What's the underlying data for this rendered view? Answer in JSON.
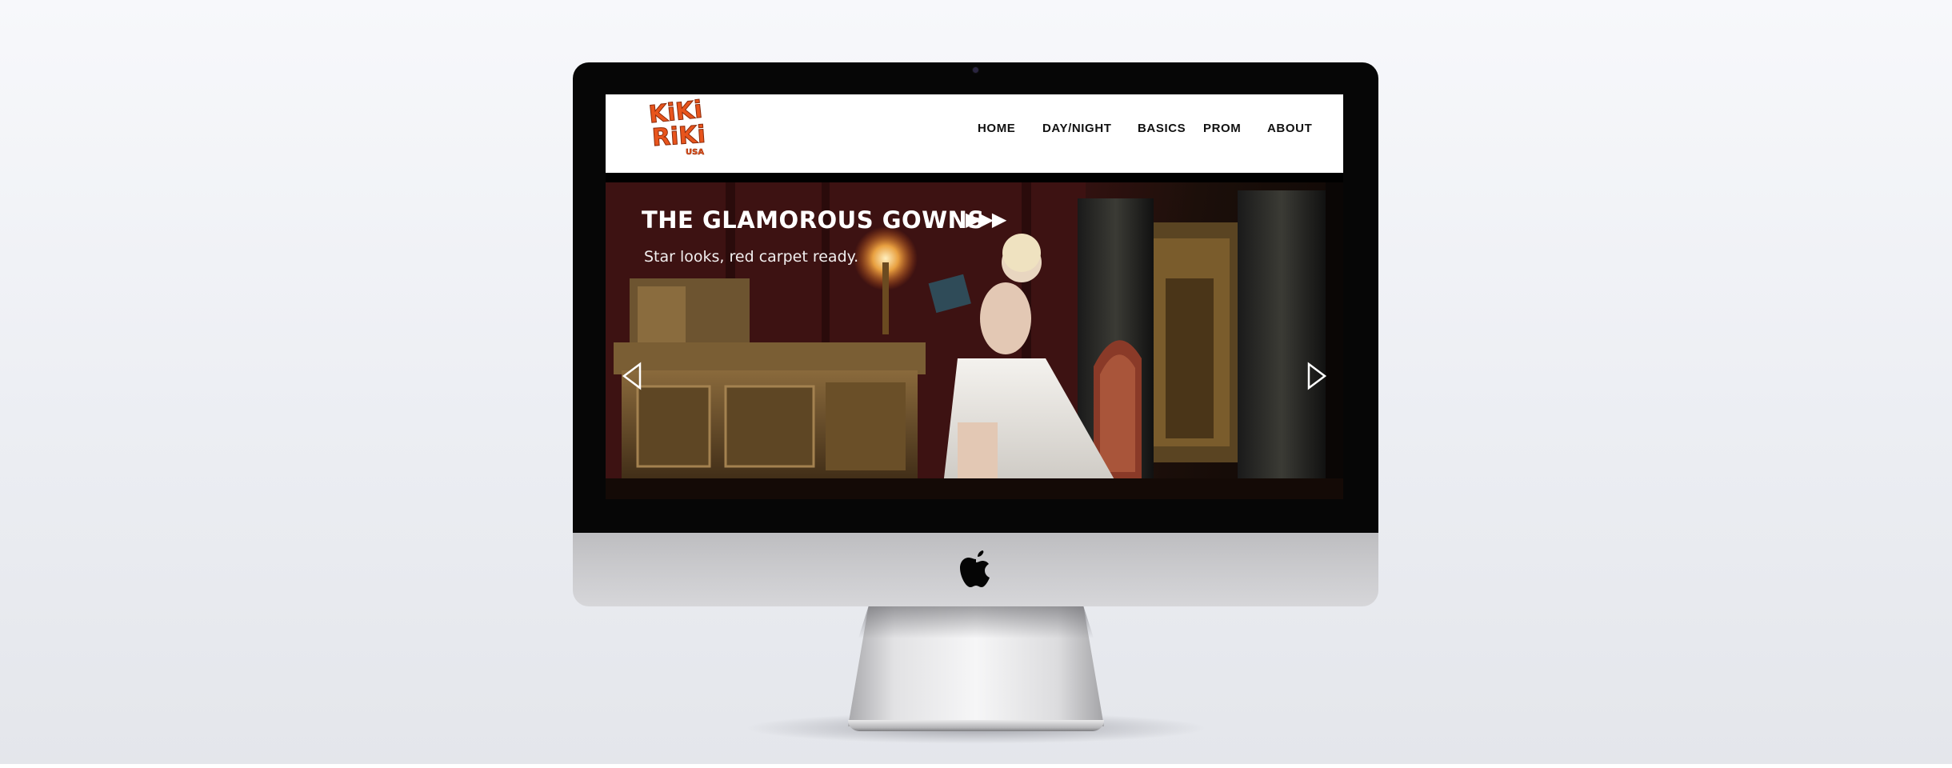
{
  "site": {
    "logo": {
      "line1": "KiKi",
      "line2": "RiKi",
      "tag": "USA"
    },
    "nav": [
      {
        "label": "HOME"
      },
      {
        "label": "DAY/NIGHT"
      },
      {
        "label": "BASICS"
      },
      {
        "label": "PROM"
      },
      {
        "label": "ABOUT"
      }
    ]
  },
  "hero": {
    "title": "THE GLAMOROUS GOWNS",
    "title_arrows": "▶▶▶",
    "subtitle": "Star looks, red carpet ready."
  },
  "colors": {
    "brand_orange": "#e8541c",
    "nav_text": "#111111",
    "bezel": "#060606",
    "chin": "#c8c8cb"
  },
  "icons": [
    "apple-logo-icon",
    "prev-arrow-icon",
    "next-arrow-icon",
    "camera-icon"
  ]
}
